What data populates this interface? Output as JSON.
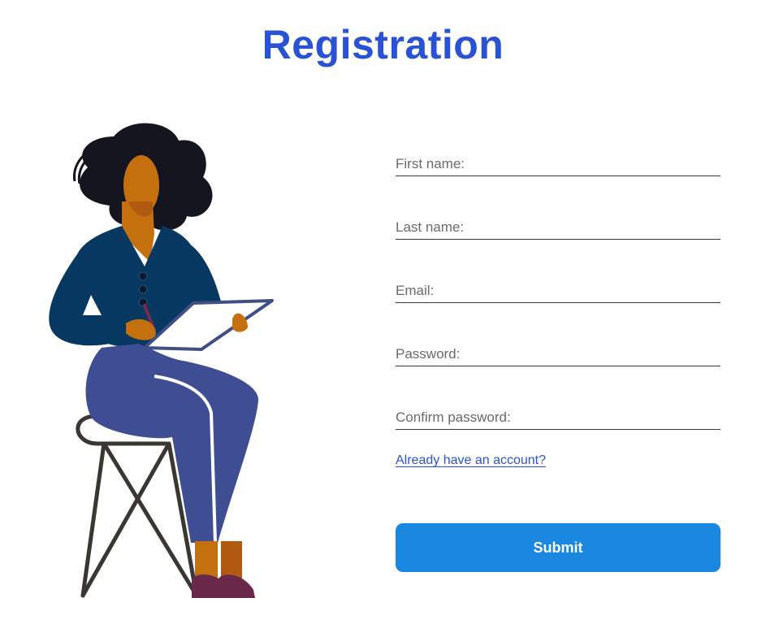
{
  "page": {
    "title": "Registration"
  },
  "form": {
    "fields": [
      {
        "name": "first-name",
        "placeholder": "First name:",
        "value": ""
      },
      {
        "name": "last-name",
        "placeholder": "Last name:",
        "value": ""
      },
      {
        "name": "email",
        "placeholder": "Email:",
        "value": ""
      },
      {
        "name": "password",
        "placeholder": "Password:",
        "value": ""
      },
      {
        "name": "confirm-password",
        "placeholder": "Confirm password:",
        "value": ""
      }
    ],
    "login_link": "Already have an account?",
    "submit_label": "Submit"
  },
  "colors": {
    "title": "#2a52d4",
    "link": "#2a52d4",
    "submit_bg": "#1a88e0",
    "submit_text": "#ffffff"
  },
  "illustration": {
    "icon": "woman-with-clipboard-illustration"
  }
}
